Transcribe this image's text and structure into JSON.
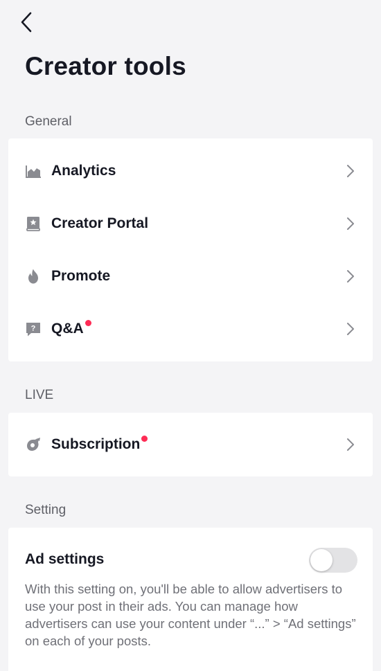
{
  "page": {
    "title": "Creator tools"
  },
  "sections": {
    "general": {
      "label": "General",
      "items": [
        {
          "label": "Analytics",
          "icon": "analytics-icon",
          "badge": false
        },
        {
          "label": "Creator Portal",
          "icon": "creator-portal-icon",
          "badge": false
        },
        {
          "label": "Promote",
          "icon": "flame-icon",
          "badge": false
        },
        {
          "label": "Q&A",
          "icon": "question-bubble-icon",
          "badge": true
        }
      ]
    },
    "live": {
      "label": "LIVE",
      "items": [
        {
          "label": "Subscription",
          "icon": "subscription-icon",
          "badge": true
        }
      ]
    },
    "setting": {
      "label": "Setting",
      "ad_settings": {
        "title": "Ad settings",
        "description": "With this setting on, you'll be able to allow advertisers to use your post in their ads. You can manage how advertisers can use your content under “...” > “Ad settings” on each of your posts.",
        "enabled": false
      }
    }
  },
  "colors": {
    "background": "#f4f4f6",
    "badge": "#fe2c55",
    "icon_gray": "#8a8b91",
    "text_primary": "#161823",
    "text_secondary": "#6f7077"
  }
}
